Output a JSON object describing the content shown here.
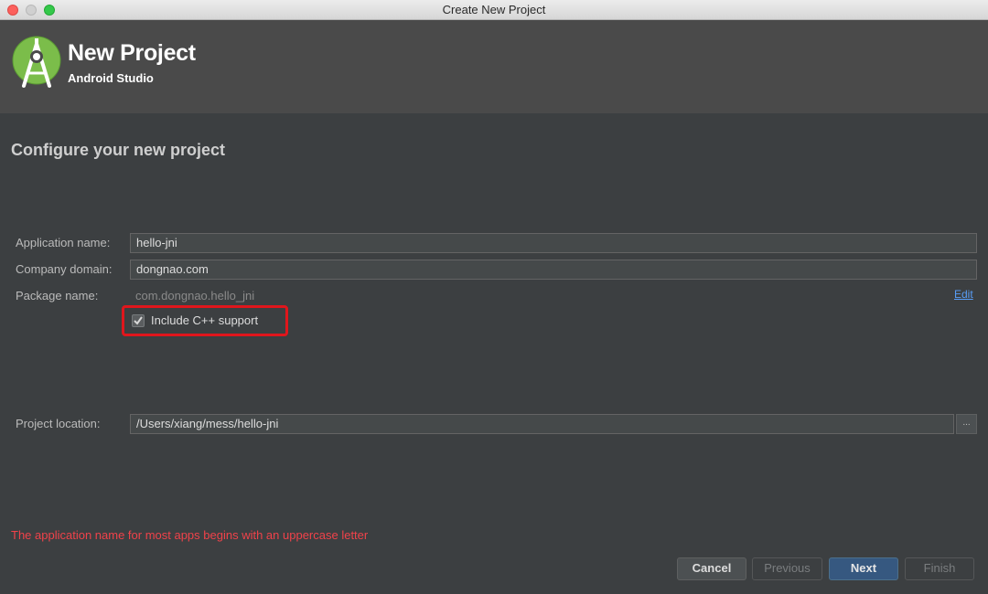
{
  "window": {
    "title": "Create New Project"
  },
  "header": {
    "title": "New Project",
    "subtitle": "Android Studio",
    "logo_icon": "android-studio-logo-icon"
  },
  "page": {
    "title": "Configure your new project"
  },
  "form": {
    "app_name_label": "Application name:",
    "app_name_value": "hello-jni",
    "company_domain_label": "Company domain:",
    "company_domain_value": "dongnao.com",
    "package_name_label": "Package name:",
    "package_name_value": "com.dongnao.hello_jni",
    "edit_label": "Edit",
    "cpp_support_label": "Include C++ support",
    "cpp_support_checked": true,
    "project_location_label": "Project location:",
    "project_location_value": "/Users/xiang/mess/hello-jni",
    "browse_label": "..."
  },
  "validation": {
    "message": "The application name for most apps begins with an uppercase letter"
  },
  "footer": {
    "cancel": "Cancel",
    "previous": "Previous",
    "next": "Next",
    "finish": "Finish"
  },
  "colors": {
    "accent": "#365880",
    "error": "#f0424a",
    "highlight": "#e0161c",
    "link": "#589df6"
  }
}
